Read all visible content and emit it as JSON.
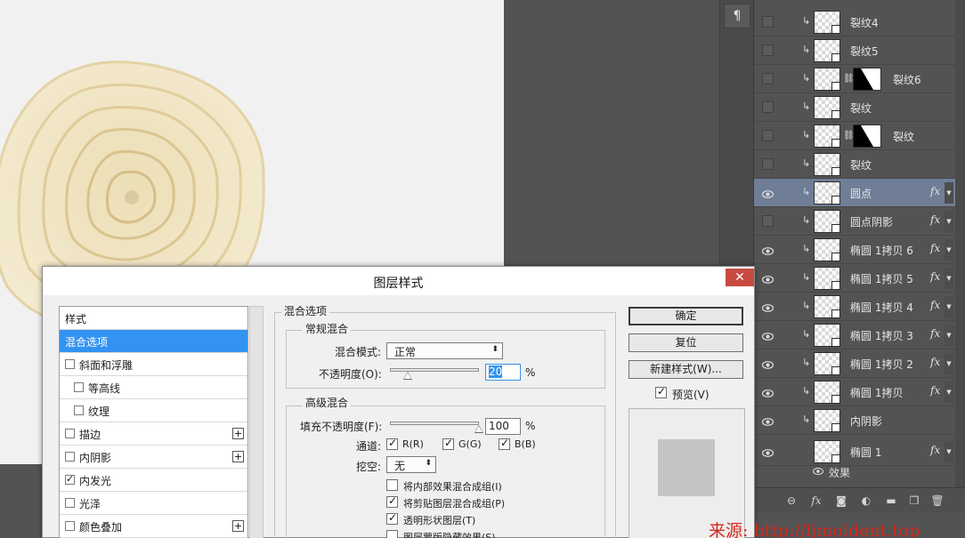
{
  "panel_icon": "paragraph-icon",
  "layers": [
    {
      "name": "裂纹4",
      "visible": false,
      "mask": false,
      "fx": false,
      "selected": false
    },
    {
      "name": "裂纹5",
      "visible": false,
      "mask": false,
      "fx": false,
      "selected": false
    },
    {
      "name": "裂纹6",
      "visible": false,
      "mask": true,
      "fx": false,
      "selected": false
    },
    {
      "name": "裂纹",
      "visible": false,
      "mask": false,
      "fx": false,
      "selected": false
    },
    {
      "name": "裂纹",
      "visible": false,
      "mask": true,
      "fx": false,
      "selected": false
    },
    {
      "name": "裂纹",
      "visible": false,
      "mask": false,
      "fx": false,
      "selected": false
    },
    {
      "name": "圆点",
      "visible": true,
      "mask": false,
      "fx": true,
      "selected": true
    },
    {
      "name": "圆点阴影",
      "visible": false,
      "mask": false,
      "fx": true,
      "selected": false
    },
    {
      "name": "椭圆 1拷贝 6",
      "visible": true,
      "mask": false,
      "fx": true,
      "selected": false
    },
    {
      "name": "椭圆 1拷贝 5",
      "visible": true,
      "mask": false,
      "fx": true,
      "selected": false
    },
    {
      "name": "椭圆 1拷贝 4",
      "visible": true,
      "mask": false,
      "fx": true,
      "selected": false
    },
    {
      "name": "椭圆 1拷贝 3",
      "visible": true,
      "mask": false,
      "fx": true,
      "selected": false
    },
    {
      "name": "椭圆 1拷贝 2",
      "visible": true,
      "mask": false,
      "fx": true,
      "selected": false
    },
    {
      "name": "椭圆 1拷贝",
      "visible": true,
      "mask": false,
      "fx": true,
      "selected": false
    },
    {
      "name": "内阴影",
      "visible": true,
      "mask": false,
      "fx": false,
      "selected": false
    },
    {
      "name": "椭圆 1",
      "visible": true,
      "mask": false,
      "fx": true,
      "selected": false
    }
  ],
  "layer_fx_label": "fx",
  "effects_label": "效果",
  "watermark": "来源: http://ljmoldent.top",
  "dialog": {
    "title": "图层样式",
    "close": "✕",
    "styles": [
      {
        "label": "样式",
        "checkbox": false,
        "checked": false,
        "plus": false,
        "indent": 0,
        "active": false
      },
      {
        "label": "混合选项",
        "checkbox": false,
        "checked": false,
        "plus": false,
        "indent": 0,
        "active": true
      },
      {
        "label": "斜面和浮雕",
        "checkbox": true,
        "checked": false,
        "plus": false,
        "indent": 0,
        "active": false
      },
      {
        "label": "等高线",
        "checkbox": true,
        "checked": false,
        "plus": false,
        "indent": 1,
        "active": false
      },
      {
        "label": "纹理",
        "checkbox": true,
        "checked": false,
        "plus": false,
        "indent": 1,
        "active": false
      },
      {
        "label": "描边",
        "checkbox": true,
        "checked": false,
        "plus": true,
        "indent": 0,
        "active": false
      },
      {
        "label": "内阴影",
        "checkbox": true,
        "checked": false,
        "plus": true,
        "indent": 0,
        "active": false
      },
      {
        "label": "内发光",
        "checkbox": true,
        "checked": true,
        "plus": false,
        "indent": 0,
        "active": false
      },
      {
        "label": "光泽",
        "checkbox": true,
        "checked": false,
        "plus": false,
        "indent": 0,
        "active": false
      },
      {
        "label": "颜色叠加",
        "checkbox": true,
        "checked": false,
        "plus": true,
        "indent": 0,
        "active": false
      }
    ],
    "blending": {
      "section_title": "混合选项",
      "general_title": "常规混合",
      "mode_label": "混合模式:",
      "mode_value": "正常",
      "opacity_label": "不透明度(O):",
      "opacity_value": "20",
      "opacity_level": 0.2,
      "percent": "%",
      "advanced_title": "高级混合",
      "fill_label": "填充不透明度(F):",
      "fill_value": "100",
      "fill_level": 1.0,
      "channels_label": "通道:",
      "channels": [
        {
          "label": "R(R)",
          "checked": true
        },
        {
          "label": "G(G)",
          "checked": true
        },
        {
          "label": "B(B)",
          "checked": true
        }
      ],
      "knockout_label": "挖空:",
      "knockout_value": "无",
      "options": [
        {
          "label": "将内部效果混合成组(I)",
          "checked": false
        },
        {
          "label": "将剪贴图层混合成组(P)",
          "checked": true
        },
        {
          "label": "透明形状图层(T)",
          "checked": true
        },
        {
          "label": "图层蒙版隐藏效果(S)",
          "checked": false
        }
      ]
    },
    "buttons": {
      "ok": "确定",
      "reset": "复位",
      "new_style": "新建样式(W)...",
      "preview": "预览(V)",
      "preview_checked": true
    }
  },
  "footer_icons": [
    "link-icon",
    "fx-icon",
    "mask-icon",
    "adjustment-icon",
    "folder-icon",
    "new-layer-icon",
    "trash-icon"
  ]
}
